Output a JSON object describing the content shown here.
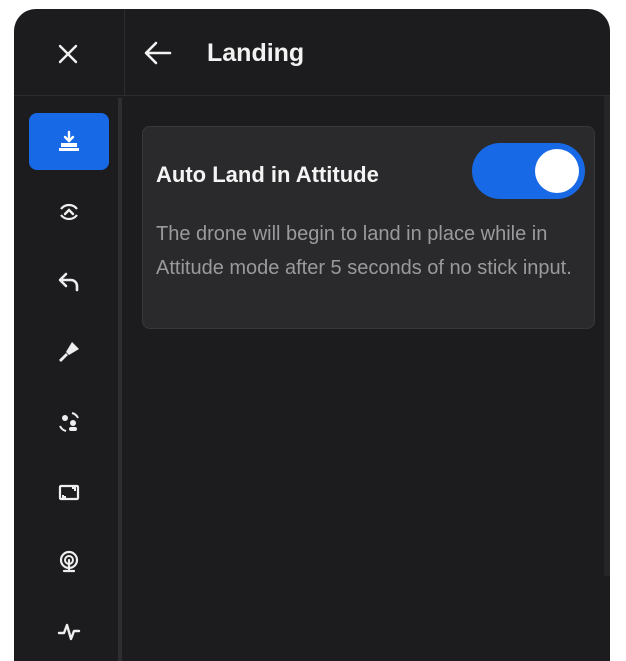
{
  "header": {
    "title": "Landing",
    "close_icon": "close-icon",
    "back_icon": "arrow-left-icon"
  },
  "sidebar": {
    "items": [
      {
        "icon": "landing-icon",
        "active": true
      },
      {
        "icon": "obstacle-avoidance-icon",
        "active": false
      },
      {
        "icon": "return-home-icon",
        "active": false
      },
      {
        "icon": "flashlight-icon",
        "active": false
      },
      {
        "icon": "tracking-icon",
        "active": false
      },
      {
        "icon": "camera-frame-icon",
        "active": false
      },
      {
        "icon": "signal-icon",
        "active": false
      },
      {
        "icon": "pulse-icon",
        "active": false
      }
    ]
  },
  "settings": {
    "auto_land": {
      "label": "Auto Land in Attitude",
      "enabled": true,
      "description": "The drone will begin to land in place while in Attitude mode after 5 seconds of no stick input."
    }
  },
  "colors": {
    "accent": "#1769e6",
    "background": "#1c1c1e",
    "card": "#2a2a2c"
  }
}
